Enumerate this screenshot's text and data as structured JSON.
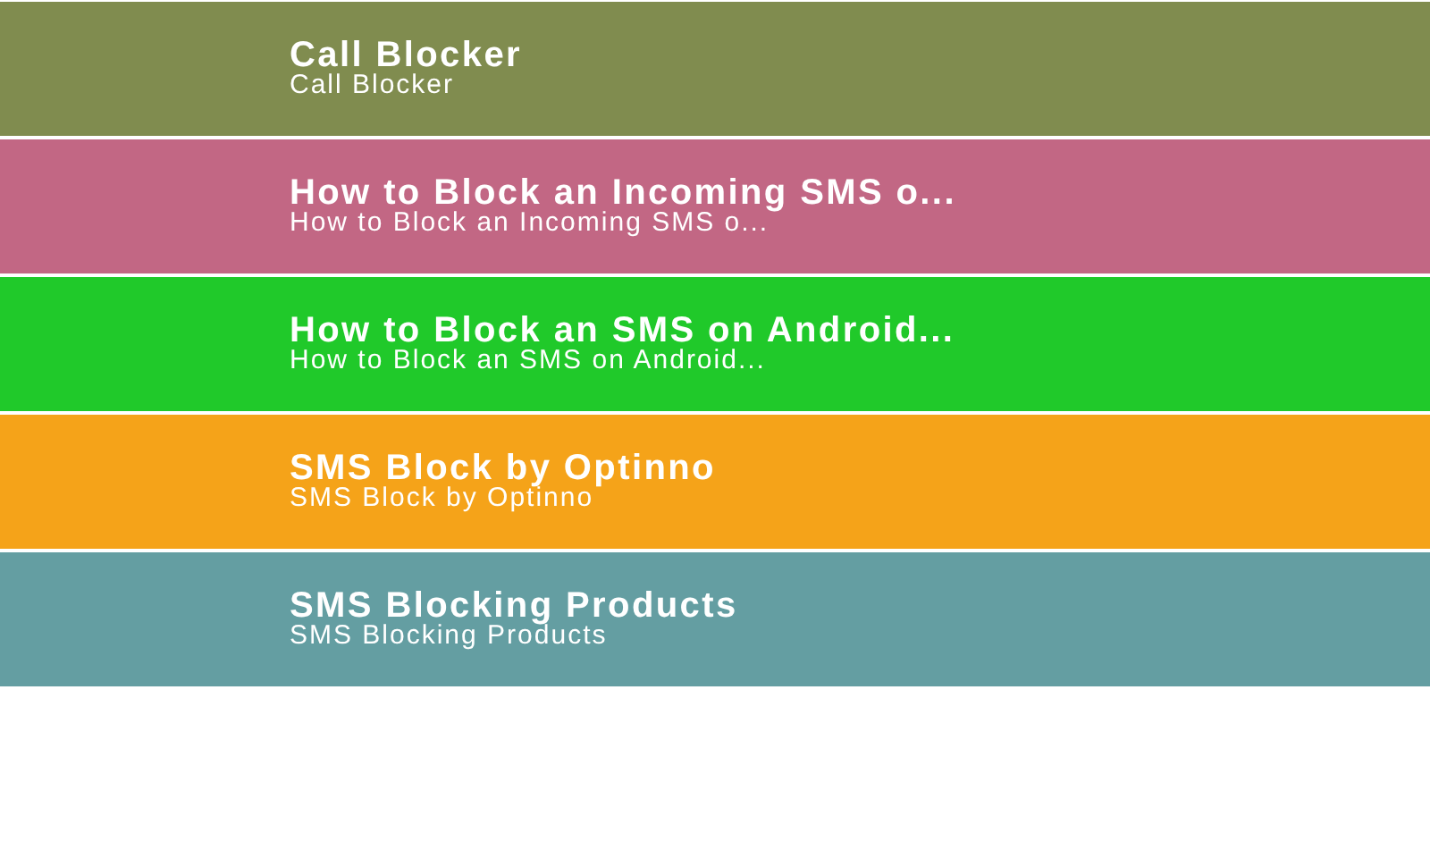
{
  "items": [
    {
      "title": "Call Blocker",
      "subtitle": "Call Blocker",
      "color": "#808c4f"
    },
    {
      "title": "How to Block an Incoming SMS o...",
      "subtitle": "How to Block an Incoming SMS o...",
      "color": "#c26784"
    },
    {
      "title": "How to Block an SMS on Android...",
      "subtitle": "How to Block an SMS on Android...",
      "color": "#20c92a"
    },
    {
      "title": "SMS Block by Optinno",
      "subtitle": "SMS Block by Optinno",
      "color": "#f5a319"
    },
    {
      "title": "SMS Blocking Products",
      "subtitle": "SMS Blocking Products",
      "color": "#649ea2"
    }
  ]
}
